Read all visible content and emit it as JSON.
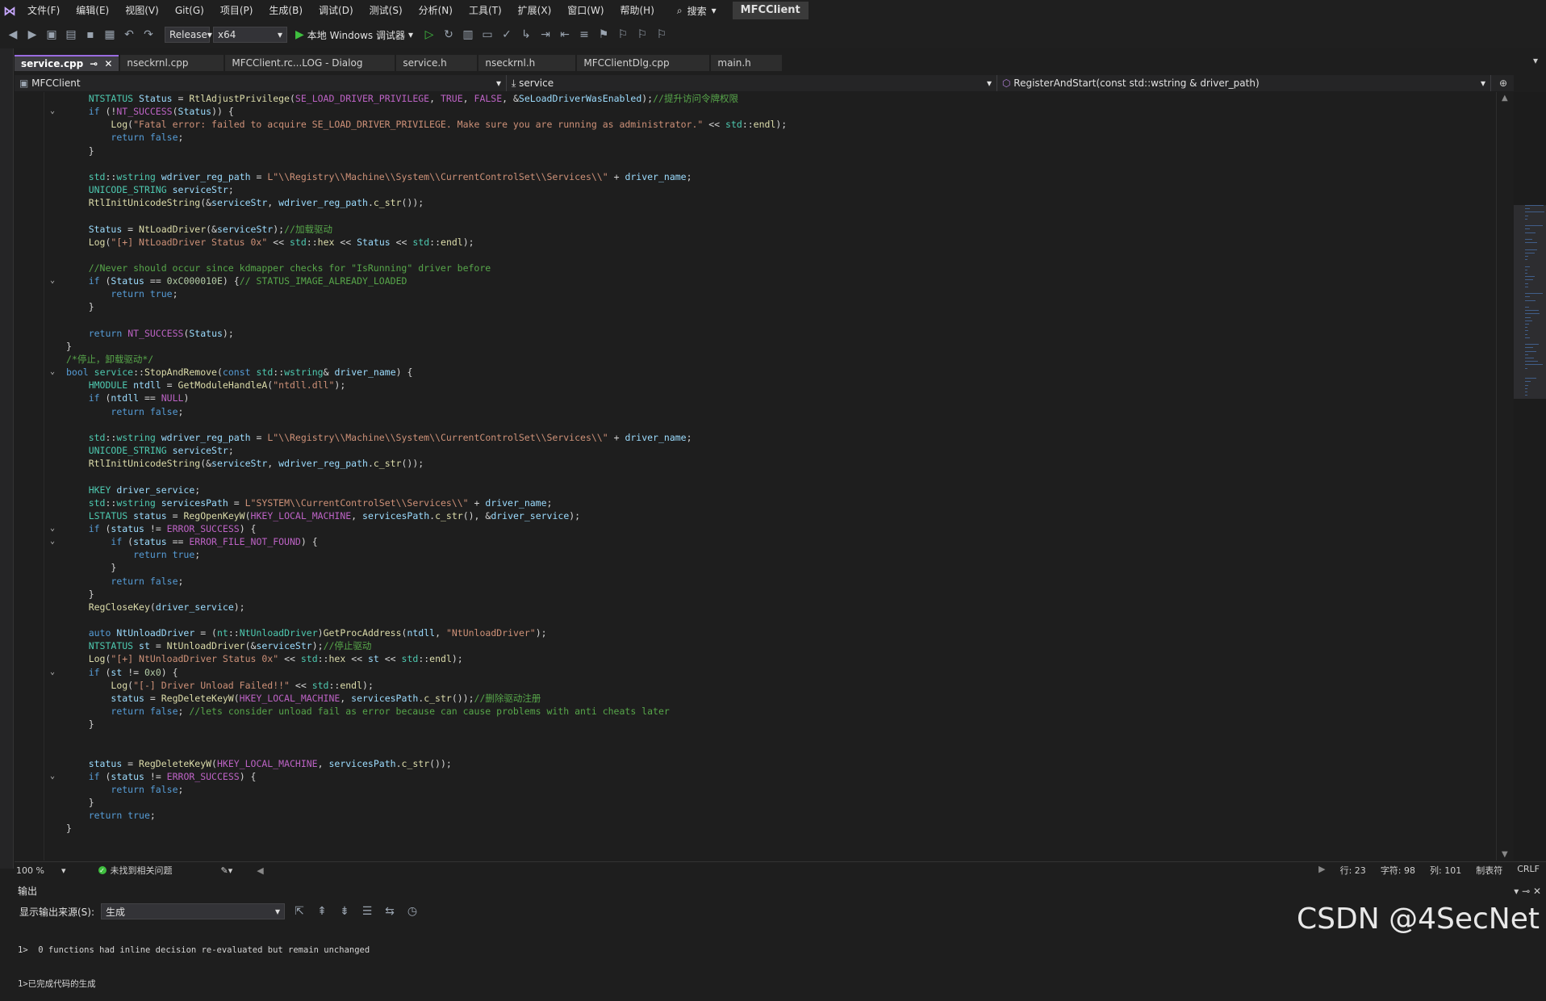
{
  "menubar": {
    "items": [
      "文件(F)",
      "编辑(E)",
      "视图(V)",
      "Git(G)",
      "项目(P)",
      "生成(B)",
      "调试(D)",
      "测试(S)",
      "分析(N)",
      "工具(T)",
      "扩展(X)",
      "窗口(W)",
      "帮助(H)"
    ],
    "search_label": "搜索",
    "solution_name": "MFCClient"
  },
  "toolbar": {
    "configuration": "Release",
    "platform": "x64",
    "run_label": "本地 Windows 调试器"
  },
  "tabs": [
    {
      "label": "service.cpp",
      "active": true
    },
    {
      "label": "nseckrnl.cpp",
      "active": false
    },
    {
      "label": "MFCClient.rc...LOG - Dialog",
      "active": false
    },
    {
      "label": "service.h",
      "active": false
    },
    {
      "label": "nseckrnl.h",
      "active": false
    },
    {
      "label": "MFCClientDlg.cpp",
      "active": false
    },
    {
      "label": "main.h",
      "active": false
    }
  ],
  "navbar": {
    "project": "MFCClient",
    "scope": "service",
    "member": "RegisterAndStart(const std::wstring & driver_path)"
  },
  "code_lines": [
    {
      "fold": "",
      "html": "    <span class=\"t\">NTSTATUS</span> <span class=\"v\">Status</span> = <span class=\"f\">RtlAdjustPrivilege</span>(<span class=\"m\">SE_LOAD_DRIVER_PRIVILEGE</span>, <span class=\"m\">TRUE</span>, <span class=\"m\">FALSE</span>, &amp;<span class=\"v\">SeLoadDriverWasEnabled</span>);<span class=\"c\">//提升访问令牌权限</span>"
    },
    {
      "fold": "v",
      "html": "    <span class=\"k\">if</span> (!<span class=\"m\">NT_SUCCESS</span>(<span class=\"v\">Status</span>)) {"
    },
    {
      "fold": "",
      "html": "        <span class=\"f\">Log</span>(<span class=\"s\">\"Fatal error: failed to acquire SE_LOAD_DRIVER_PRIVILEGE. Make sure you are running as administrator.\"</span> &lt;&lt; <span class=\"t\">std</span>::<span class=\"f\">endl</span>);"
    },
    {
      "fold": "",
      "html": "        <span class=\"k\">return</span> <span class=\"k\">false</span>;"
    },
    {
      "fold": "",
      "html": "    }"
    },
    {
      "fold": "",
      "html": ""
    },
    {
      "fold": "",
      "html": "    <span class=\"t\">std</span>::<span class=\"t\">wstring</span> <span class=\"v\">wdriver_reg_path</span> = <span class=\"s\">L\"\\\\Registry\\\\Machine\\\\System\\\\CurrentControlSet\\\\Services\\\\\"</span> + <span class=\"v\">driver_name</span>;"
    },
    {
      "fold": "",
      "html": "    <span class=\"t\">UNICODE_STRING</span> <span class=\"v\">serviceStr</span>;"
    },
    {
      "fold": "",
      "html": "    <span class=\"f\">RtlInitUnicodeString</span>(&amp;<span class=\"v\">serviceStr</span>, <span class=\"v\">wdriver_reg_path</span>.<span class=\"f\">c_str</span>());"
    },
    {
      "fold": "",
      "html": ""
    },
    {
      "fold": "",
      "html": "    <span class=\"v\">Status</span> = <span class=\"f\">NtLoadDriver</span>(&amp;<span class=\"v\">serviceStr</span>);<span class=\"c\">//加载驱动</span>"
    },
    {
      "fold": "",
      "html": "    <span class=\"f\">Log</span>(<span class=\"s\">\"[+] NtLoadDriver Status 0x\"</span> &lt;&lt; <span class=\"t\">std</span>::<span class=\"f\">hex</span> &lt;&lt; <span class=\"v\">Status</span> &lt;&lt; <span class=\"t\">std</span>::<span class=\"f\">endl</span>);"
    },
    {
      "fold": "",
      "html": ""
    },
    {
      "fold": "",
      "html": "    <span class=\"c\">//Never should occur since kdmapper checks for \"IsRunning\" driver before</span>"
    },
    {
      "fold": "v",
      "html": "    <span class=\"k\">if</span> (<span class=\"v\">Status</span> == <span class=\"n\">0xC000010E</span>) {<span class=\"c\">// STATUS_IMAGE_ALREADY_LOADED</span>"
    },
    {
      "fold": "",
      "html": "        <span class=\"k\">return</span> <span class=\"k\">true</span>;"
    },
    {
      "fold": "",
      "html": "    }"
    },
    {
      "fold": "",
      "html": ""
    },
    {
      "fold": "",
      "html": "    <span class=\"k\">return</span> <span class=\"m\">NT_SUCCESS</span>(<span class=\"v\">Status</span>);"
    },
    {
      "fold": "",
      "html": "}"
    },
    {
      "fold": "",
      "html": "<span class=\"c\">/*停止，卸载驱动*/</span>"
    },
    {
      "fold": "v",
      "html": "<span class=\"k\">bool</span> <span class=\"t\">service</span>::<span class=\"f\">StopAndRemove</span>(<span class=\"k\">const</span> <span class=\"t\">std</span>::<span class=\"t\">wstring</span>&amp; <span class=\"v\">driver_name</span>) {"
    },
    {
      "fold": "",
      "html": "    <span class=\"t\">HMODULE</span> <span class=\"v\">ntdll</span> = <span class=\"f\">GetModuleHandleA</span>(<span class=\"s\">\"ntdll.dll\"</span>);"
    },
    {
      "fold": "",
      "html": "    <span class=\"k\">if</span> (<span class=\"v\">ntdll</span> == <span class=\"m\">NULL</span>)"
    },
    {
      "fold": "",
      "html": "        <span class=\"k\">return</span> <span class=\"k\">false</span>;"
    },
    {
      "fold": "",
      "html": ""
    },
    {
      "fold": "",
      "html": "    <span class=\"t\">std</span>::<span class=\"t\">wstring</span> <span class=\"v\">wdriver_reg_path</span> = <span class=\"s\">L\"\\\\Registry\\\\Machine\\\\System\\\\CurrentControlSet\\\\Services\\\\\"</span> + <span class=\"v\">driver_name</span>;"
    },
    {
      "fold": "",
      "html": "    <span class=\"t\">UNICODE_STRING</span> <span class=\"v\">serviceStr</span>;"
    },
    {
      "fold": "",
      "html": "    <span class=\"f\">RtlInitUnicodeString</span>(&amp;<span class=\"v\">serviceStr</span>, <span class=\"v\">wdriver_reg_path</span>.<span class=\"f\">c_str</span>());"
    },
    {
      "fold": "",
      "html": ""
    },
    {
      "fold": "",
      "html": "    <span class=\"t\">HKEY</span> <span class=\"v\">driver_service</span>;"
    },
    {
      "fold": "",
      "html": "    <span class=\"t\">std</span>::<span class=\"t\">wstring</span> <span class=\"v\">servicesPath</span> = <span class=\"s\">L\"SYSTEM\\\\CurrentControlSet\\\\Services\\\\\"</span> + <span class=\"v\">driver_name</span>;"
    },
    {
      "fold": "",
      "html": "    <span class=\"t\">LSTATUS</span> <span class=\"v\">status</span> = <span class=\"f\">RegOpenKeyW</span>(<span class=\"m\">HKEY_LOCAL_MACHINE</span>, <span class=\"v\">servicesPath</span>.<span class=\"f\">c_str</span>(), &amp;<span class=\"v\">driver_service</span>);"
    },
    {
      "fold": "v",
      "html": "    <span class=\"k\">if</span> (<span class=\"v\">status</span> != <span class=\"m\">ERROR_SUCCESS</span>) {"
    },
    {
      "fold": "v",
      "html": "        <span class=\"k\">if</span> (<span class=\"v\">status</span> == <span class=\"m\">ERROR_FILE_NOT_FOUND</span>) {"
    },
    {
      "fold": "",
      "html": "            <span class=\"k\">return</span> <span class=\"k\">true</span>;"
    },
    {
      "fold": "",
      "html": "        }"
    },
    {
      "fold": "",
      "html": "        <span class=\"k\">return</span> <span class=\"k\">false</span>;"
    },
    {
      "fold": "",
      "html": "    }"
    },
    {
      "fold": "",
      "html": "    <span class=\"f\">RegCloseKey</span>(<span class=\"v\">driver_service</span>);"
    },
    {
      "fold": "",
      "html": ""
    },
    {
      "fold": "",
      "html": "    <span class=\"k\">auto</span> <span class=\"v\">NtUnloadDriver</span> = (<span class=\"t\">nt</span>::<span class=\"t\">NtUnloadDriver</span>)<span class=\"f\">GetProcAddress</span>(<span class=\"v\">ntdll</span>, <span class=\"s\">\"NtUnloadDriver\"</span>);"
    },
    {
      "fold": "",
      "html": "    <span class=\"t\">NTSTATUS</span> <span class=\"v\">st</span> = <span class=\"f\">NtUnloadDriver</span>(&amp;<span class=\"v\">serviceStr</span>);<span class=\"c\">//停止驱动</span>"
    },
    {
      "fold": "",
      "html": "    <span class=\"f\">Log</span>(<span class=\"s\">\"[+] NtUnloadDriver Status 0x\"</span> &lt;&lt; <span class=\"t\">std</span>::<span class=\"f\">hex</span> &lt;&lt; <span class=\"v\">st</span> &lt;&lt; <span class=\"t\">std</span>::<span class=\"f\">endl</span>);"
    },
    {
      "fold": "v",
      "html": "    <span class=\"k\">if</span> (<span class=\"v\">st</span> != <span class=\"n\">0x0</span>) {"
    },
    {
      "fold": "",
      "html": "        <span class=\"f\">Log</span>(<span class=\"s\">\"[-] Driver Unload Failed!!\"</span> &lt;&lt; <span class=\"t\">std</span>::<span class=\"f\">endl</span>);"
    },
    {
      "fold": "",
      "html": "        <span class=\"v\">status</span> = <span class=\"f\">RegDeleteKeyW</span>(<span class=\"m\">HKEY_LOCAL_MACHINE</span>, <span class=\"v\">servicesPath</span>.<span class=\"f\">c_str</span>());<span class=\"c\">//删除驱动注册</span>"
    },
    {
      "fold": "",
      "html": "        <span class=\"k\">return</span> <span class=\"k\">false</span>; <span class=\"c\">//lets consider unload fail as error because can cause problems with anti cheats later</span>"
    },
    {
      "fold": "",
      "html": "    }"
    },
    {
      "fold": "",
      "html": ""
    },
    {
      "fold": "",
      "html": ""
    },
    {
      "fold": "",
      "html": "    <span class=\"v\">status</span> = <span class=\"f\">RegDeleteKeyW</span>(<span class=\"m\">HKEY_LOCAL_MACHINE</span>, <span class=\"v\">servicesPath</span>.<span class=\"f\">c_str</span>());"
    },
    {
      "fold": "v",
      "html": "    <span class=\"k\">if</span> (<span class=\"v\">status</span> != <span class=\"m\">ERROR_SUCCESS</span>) {"
    },
    {
      "fold": "",
      "html": "        <span class=\"k\">return</span> <span class=\"k\">false</span>;"
    },
    {
      "fold": "",
      "html": "    }"
    },
    {
      "fold": "",
      "html": "    <span class=\"k\">return</span> <span class=\"k\">true</span>;"
    },
    {
      "fold": "",
      "html": "}"
    }
  ],
  "statusbar": {
    "zoom": "100 %",
    "issues": "未找到相关问题",
    "line": "行: 23",
    "char": "字符: 98",
    "col": "列: 101",
    "tabs": "制表符",
    "eol": "CRLF"
  },
  "output": {
    "title": "输出",
    "source_label": "显示输出来源(S):",
    "source_value": "生成",
    "lines": [
      "1>  0 functions had inline decision re-evaluated but remain unchanged",
      "1>已完成代码的生成"
    ]
  },
  "watermark": "CSDN @4SecNet"
}
